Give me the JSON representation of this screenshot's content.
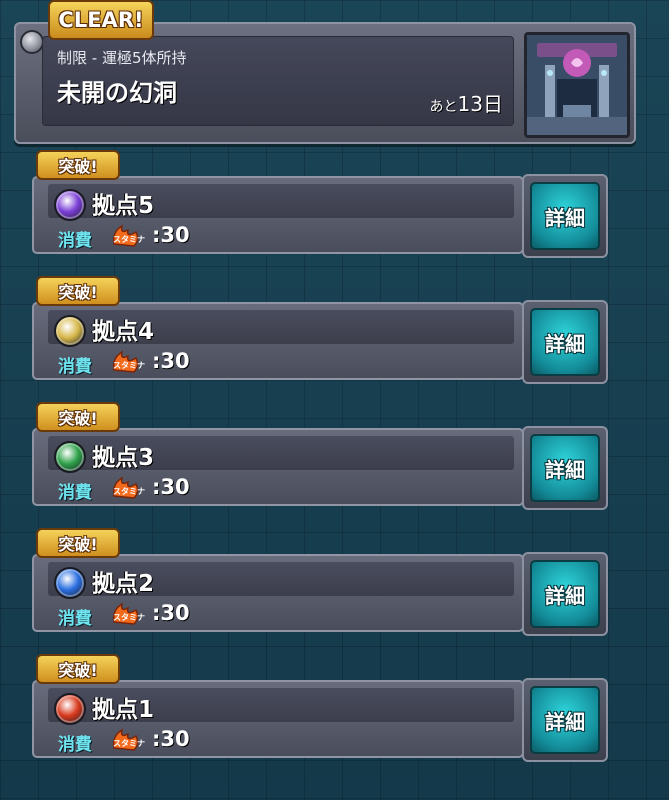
{
  "header": {
    "clear_label": "CLEAR!",
    "limit_text": "制限 - 運極5体所持",
    "title": "未開の幻洞",
    "remaining_prefix": "あと",
    "remaining_value": "13日"
  },
  "stages": [
    {
      "badge": "突破!",
      "name": "拠点5",
      "cost_label": "消費",
      "stamina_label": "スタミナ",
      "cost_value": ":30",
      "detail_label": "詳細",
      "element_color": "#7b3fd6",
      "element_icon": "dark-orb-icon"
    },
    {
      "badge": "突破!",
      "name": "拠点4",
      "cost_label": "消費",
      "stamina_label": "スタミナ",
      "cost_value": ":30",
      "detail_label": "詳細",
      "element_color": "#d7b84a",
      "element_icon": "light-orb-icon"
    },
    {
      "badge": "突破!",
      "name": "拠点3",
      "cost_label": "消費",
      "stamina_label": "スタミナ",
      "cost_value": ":30",
      "detail_label": "詳細",
      "element_color": "#2fa24a",
      "element_icon": "wood-orb-icon"
    },
    {
      "badge": "突破!",
      "name": "拠点2",
      "cost_label": "消費",
      "stamina_label": "スタミナ",
      "cost_value": ":30",
      "detail_label": "詳細",
      "element_color": "#2a6fe0",
      "element_icon": "water-orb-icon"
    },
    {
      "badge": "突破!",
      "name": "拠点1",
      "cost_label": "消費",
      "stamina_label": "スタミナ",
      "cost_value": ":30",
      "detail_label": "詳細",
      "element_color": "#d83a1e",
      "element_icon": "fire-orb-icon"
    }
  ]
}
